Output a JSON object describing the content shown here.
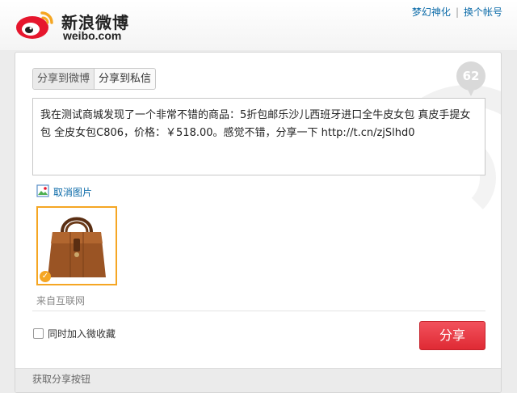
{
  "header": {
    "logo_cn": "新浪微博",
    "logo_en": "weibo.com",
    "links": [
      "梦幻神化",
      "换个帐号"
    ],
    "separator": "|"
  },
  "tabs": [
    {
      "label": "分享到微博",
      "active": true
    },
    {
      "label": "分享到私信",
      "active": false
    }
  ],
  "counter": "62",
  "compose": {
    "text": "我在测试商城发现了一个非常不错的商品：5折包邮乐沙儿西班牙进口全牛皮女包 真皮手提女包 全皮女包C806，价格：￥518.00。感觉不错，分享一下 http://t.cn/zjSlhd0"
  },
  "image": {
    "cancel_label": "取消图片",
    "source": "来自互联网",
    "selected": true
  },
  "favorite": {
    "label": "同时加入微收藏",
    "checked": false
  },
  "share_button": "分享",
  "footer": "获取分享按钮",
  "colors": {
    "link": "#0a6aa8",
    "share_button": "#e83a44",
    "thumb_border": "#f5a623",
    "counter_bg": "#d9d9d9"
  }
}
